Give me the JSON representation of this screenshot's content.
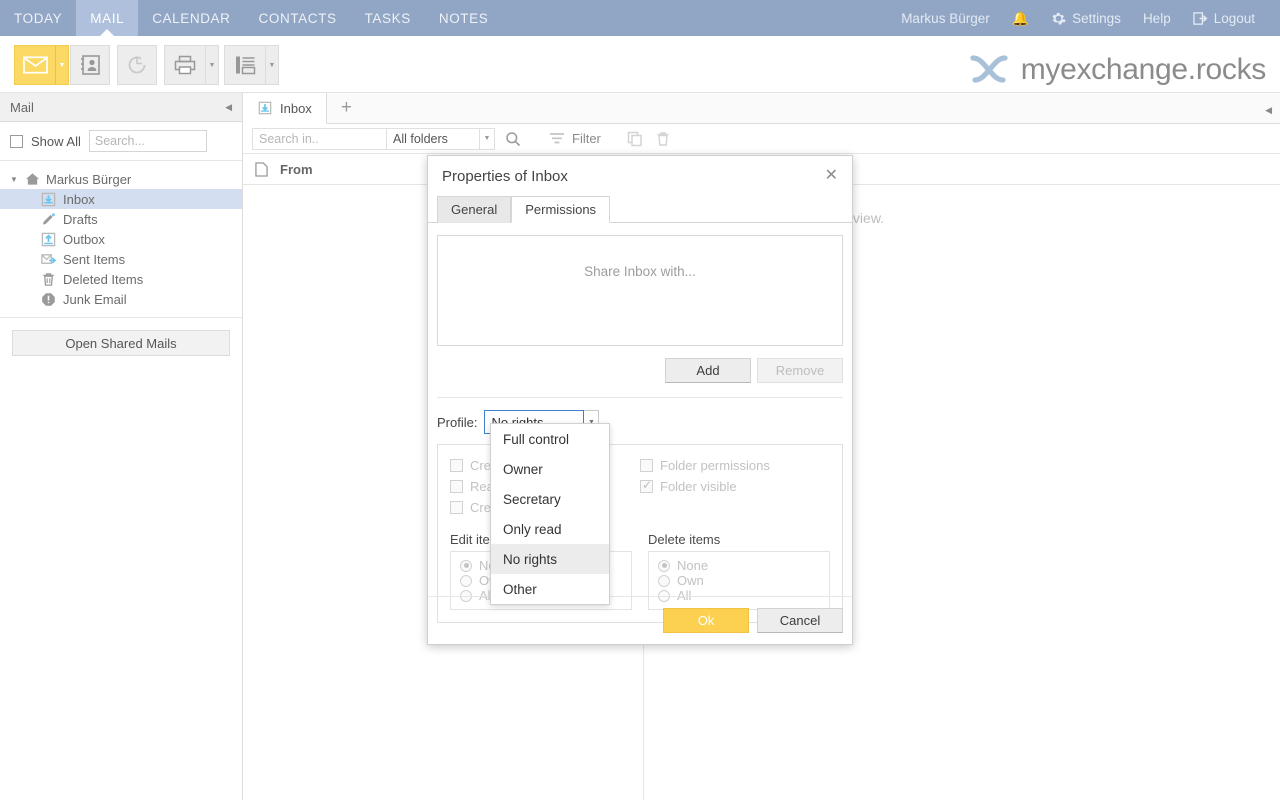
{
  "topnav": {
    "tabs": [
      {
        "label": "TODAY",
        "active": false
      },
      {
        "label": "MAIL",
        "active": true
      },
      {
        "label": "CALENDAR",
        "active": false
      },
      {
        "label": "CONTACTS",
        "active": false
      },
      {
        "label": "TASKS",
        "active": false
      },
      {
        "label": "NOTES",
        "active": false
      }
    ],
    "user": "Markus Bürger",
    "bell_icon": "bell-icon",
    "settings": "Settings",
    "settings_icon": "gear-icon",
    "help": "Help",
    "logout": "Logout",
    "logout_icon": "logout-icon",
    "bar_color": "#91a5c4",
    "active_tab_color": "#afc0dc"
  },
  "toolbar": {
    "buttons": [
      {
        "icon": "mail-icon",
        "highlighted": true,
        "has_arrow": true
      },
      {
        "icon": "address-book-icon",
        "highlighted": false,
        "has_arrow": false
      },
      {
        "icon": "sync-icon",
        "highlighted": false,
        "has_arrow": false
      },
      {
        "icon": "print-icon",
        "highlighted": false,
        "has_arrow": true
      },
      {
        "icon": "layout-icon",
        "highlighted": false,
        "has_arrow": true
      }
    ],
    "highlight_color": "#fcd964"
  },
  "logo": {
    "text": "myexchange.rocks",
    "icon": "knot-logo-icon",
    "color": "#a8c0d8"
  },
  "sidebar": {
    "title": "Mail",
    "collapse_icon": "collapse-left-icon",
    "show_all_label": "Show All",
    "show_all_checked": false,
    "search_placeholder": "Search...",
    "search_value": "",
    "root": {
      "label": "Markus Bürger",
      "icon": "home-icon"
    },
    "items": [
      {
        "label": "Inbox",
        "icon": "inbox-icon",
        "selected": true
      },
      {
        "label": "Drafts",
        "icon": "pencil-icon",
        "selected": false
      },
      {
        "label": "Outbox",
        "icon": "outbox-icon",
        "selected": false
      },
      {
        "label": "Sent Items",
        "icon": "sent-icon",
        "selected": false
      },
      {
        "label": "Deleted Items",
        "icon": "trash-icon",
        "selected": false
      },
      {
        "label": "Junk Email",
        "icon": "warning-icon",
        "selected": false
      }
    ],
    "shared_button": "Open Shared Mails",
    "selection_color": "#d3def0"
  },
  "main": {
    "tab": {
      "label": "Inbox",
      "icon": "inbox-icon"
    },
    "add_tab_icon": "plus-icon",
    "search_placeholder": "Search in..",
    "search_value": "",
    "folder_filter": "All folders",
    "search_icon": "search-icon",
    "filter_label": "Filter",
    "filter_icon": "filter-icon",
    "copy_icon": "copy-icon",
    "delete_icon": "trash-icon",
    "column_header": "From",
    "column_icon": "document-icon",
    "empty_message": "There are no items to show in this view.",
    "right_collapse_icon": "collapse-left-icon"
  },
  "dialog": {
    "title": "Properties of Inbox",
    "close_icon": "close-icon",
    "tabs": [
      {
        "label": "General",
        "active": false
      },
      {
        "label": "Permissions",
        "active": true
      }
    ],
    "share_placeholder": "Share Inbox with...",
    "add_label": "Add",
    "remove_label": "Remove",
    "remove_disabled": true,
    "profile_label": "Profile:",
    "profile_value": "No rights",
    "profile_arrow_icon": "chevron-down-icon",
    "dropdown_options": [
      {
        "label": "Full control",
        "highlighted": false
      },
      {
        "label": "Owner",
        "highlighted": false
      },
      {
        "label": "Secretary",
        "highlighted": false
      },
      {
        "label": "Only read",
        "highlighted": false
      },
      {
        "label": "No rights",
        "highlighted": true
      },
      {
        "label": "Other",
        "highlighted": false
      }
    ],
    "permissions_left": [
      {
        "label": "Create items",
        "checked": false
      },
      {
        "label": "Read items",
        "checked": false
      },
      {
        "label": "Create subfolders",
        "checked": false
      }
    ],
    "permissions_right": [
      {
        "label": "Folder permissions",
        "checked": false
      },
      {
        "label": "Folder visible",
        "checked": true
      }
    ],
    "edit_items": {
      "title": "Edit items",
      "options": [
        {
          "label": "None",
          "selected": true
        },
        {
          "label": "Own",
          "selected": false
        },
        {
          "label": "All",
          "selected": false
        }
      ]
    },
    "delete_items": {
      "title": "Delete items",
      "options": [
        {
          "label": "None",
          "selected": true
        },
        {
          "label": "Own",
          "selected": false
        },
        {
          "label": "All",
          "selected": false
        }
      ]
    },
    "ok_label": "Ok",
    "cancel_label": "Cancel",
    "ok_color": "#fcd050"
  }
}
